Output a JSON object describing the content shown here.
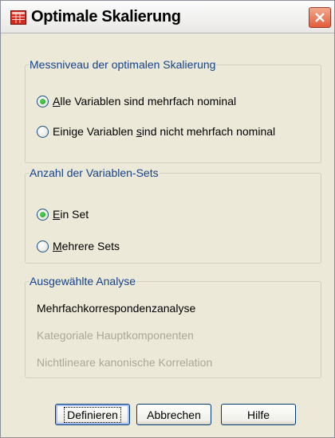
{
  "window": {
    "title": "Optimale Skalierung"
  },
  "measurement": {
    "legend": "Messniveau der optimalen Skalierung",
    "options": [
      {
        "pre": "",
        "mnemonic": "A",
        "post": "lle Variablen sind mehrfach nominal",
        "selected": true
      },
      {
        "pre": "Einige Variablen ",
        "mnemonic": "s",
        "post": "ind nicht mehrfach nominal",
        "selected": false
      }
    ]
  },
  "variable_sets": {
    "legend": "Anzahl der Variablen-Sets",
    "options": [
      {
        "pre": "",
        "mnemonic": "E",
        "post": "in Set",
        "selected": true
      },
      {
        "pre": "",
        "mnemonic": "M",
        "post": "ehrere Sets",
        "selected": false
      }
    ]
  },
  "analysis": {
    "legend": "Ausgewählte Analyse",
    "items": [
      {
        "label": "Mehrfachkorrespondenzanalyse",
        "enabled": true
      },
      {
        "label": "Kategoriale Hauptkomponenten",
        "enabled": false
      },
      {
        "label": "Nichtlineare kanonische Korrelation",
        "enabled": false
      }
    ]
  },
  "buttons": {
    "define": "Definieren",
    "cancel": "Abbrechen",
    "help": "Hilfe"
  },
  "icons": {
    "app": "spss-grid-icon",
    "close": "close-icon"
  }
}
